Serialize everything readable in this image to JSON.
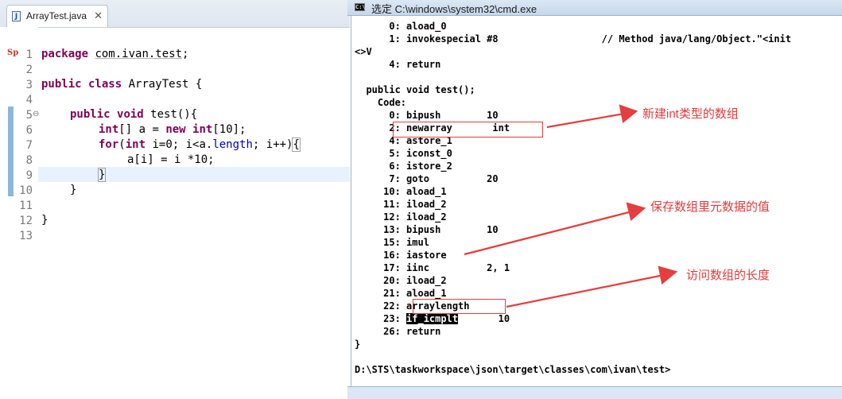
{
  "editor": {
    "tab_label": "ArrayTest.java",
    "tab_close": "✕",
    "file_icon": "J",
    "sp_marker": "Sp",
    "line_numbers": [
      "1",
      "2",
      "3",
      "4",
      "5",
      "6",
      "7",
      "8",
      "9",
      "10",
      "11",
      "12",
      "13"
    ],
    "fold_icon": "⊖",
    "code": {
      "l1_kw": "package",
      "l1_pkg": "com.ivan.test",
      "l1_end": ";",
      "l3_kw": "public class",
      "l3_rest": " ArrayTest {",
      "l5_kw1": "public",
      "l5_kw2": "void",
      "l5_rest": " test(){",
      "l6_kw": "int",
      "l6_mid": "[] a = ",
      "l6_kw2": "new",
      "l6_kw3": "int",
      "l6_end": "[10];",
      "l7_kw": "for",
      "l7_open": "(",
      "l7_kw2": "int",
      "l7_mid": " i=0; i<a.",
      "l7_field": "length",
      "l7_end": "; i++)",
      "l7_brace": "{",
      "l8": "a[i] = i *10;",
      "l9": "}",
      "l10": "}",
      "l12": "}"
    }
  },
  "cmd": {
    "icon": "C:\\",
    "title": "选定 C:\\windows\\system32\\cmd.exe",
    "lines": [
      "      0: aload_0",
      "      1: invokespecial #8                  // Method java/lang/Object.\"<init",
      "<>V",
      "      4: return",
      "",
      "  public void test();",
      "    Code:",
      "      0: bipush        10",
      "      2: newarray       int",
      "      4: astore_1",
      "      5: iconst_0",
      "      6: istore_2",
      "      7: goto          20",
      "     10: aload_1",
      "     11: iload_2",
      "     12: iload_2",
      "     13: bipush        10",
      "     15: imul",
      "     16: iastore",
      "     17: iinc          2, 1",
      "     20: iload_2",
      "     21: aload_1",
      "     22: arraylength",
      "     23: ",
      "     26: return",
      "}",
      "",
      "D:\\STS\\taskworkspace\\json\\target\\classes\\com\\ivan\\test>"
    ],
    "line23_sel": "if_icmplt",
    "line23_rest": "       10"
  },
  "annotations": {
    "note1": "新建int类型的数组",
    "note2": "保存数组里元数据的值",
    "note3": "访问数组的长度",
    "color": "#e53e3e"
  }
}
